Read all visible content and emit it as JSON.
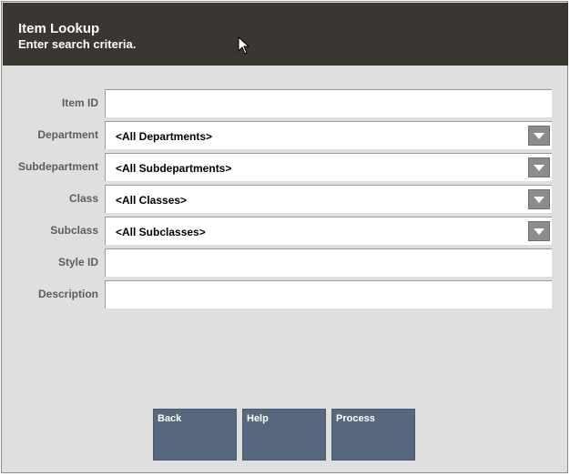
{
  "header": {
    "title": "Item Lookup",
    "subtitle": "Enter search criteria."
  },
  "form": {
    "item_id": {
      "label": "Item ID",
      "value": ""
    },
    "department": {
      "label": "Department",
      "value": "<All Departments>"
    },
    "subdepartment": {
      "label": "Subdepartment",
      "value": "<All Subdepartments>"
    },
    "class": {
      "label": "Class",
      "value": "<All Classes>"
    },
    "subclass": {
      "label": "Subclass",
      "value": "<All Subclasses>"
    },
    "style_id": {
      "label": "Style ID",
      "value": ""
    },
    "description": {
      "label": "Description",
      "value": ""
    }
  },
  "buttons": {
    "back": "Back",
    "help": "Help",
    "process": "Process"
  },
  "icons": {
    "dropdown": "chevron-down-icon",
    "cursor": "mouse-pointer-icon"
  },
  "colors": {
    "header_bg": "#3a3632",
    "panel_bg": "#dfdfdf",
    "button_bg": "#56677e"
  }
}
